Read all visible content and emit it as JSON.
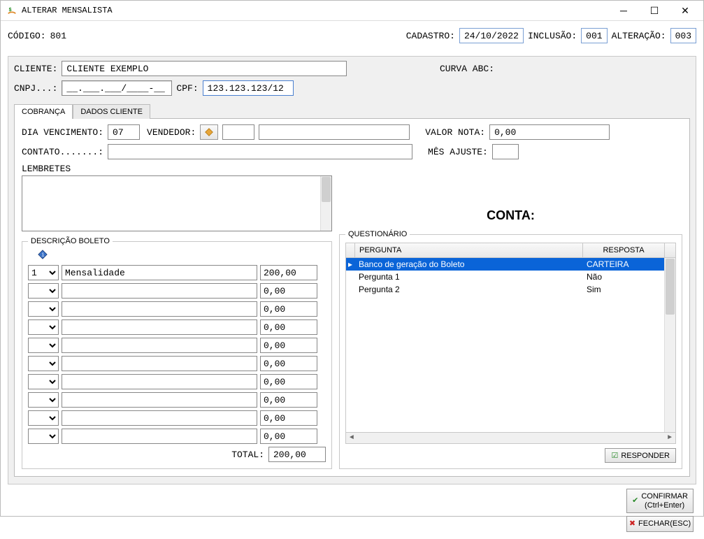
{
  "title": "ALTERAR MENSALISTA",
  "codigo_label": "CÓDIGO:",
  "codigo_value": "801",
  "cadastro_label": "CADASTRO:",
  "cadastro_value": "24/10/2022",
  "inclusao_label": "INCLUSÃO:",
  "inclusao_value": "001",
  "alteracao_label": "ALTERAÇÃO:",
  "alteracao_value": "003",
  "cliente_label": "CLIENTE:",
  "cliente_value": "CLIENTE EXEMPLO",
  "curva_label": "CURVA ABC:",
  "cnpj_label": "CNPJ...:",
  "cnpj_value": "__.___.___/____-__",
  "cpf_label": "CPF:",
  "cpf_value": "123.123.123/12",
  "tabs": {
    "cobranca": "COBRANÇA",
    "dados": "DADOS CLIENTE"
  },
  "dia_venc_label": "DIA VENCIMENTO:",
  "dia_venc_value": "07",
  "vendedor_label": "VENDEDOR:",
  "vendedor_code": "",
  "vendedor_name": "",
  "valor_nota_label": "VALOR NOTA:",
  "valor_nota_value": "0,00",
  "contato_label": "CONTATO.......:",
  "contato_value": "",
  "mes_ajuste_label": "MÊS AJUSTE:",
  "mes_ajuste_value": "",
  "lembretes_label": "LEMBRETES",
  "desc_boleto_legend": "DESCRIÇÃO BOLETO",
  "desc_rows": [
    {
      "opt": "1",
      "desc": "Mensalidade",
      "val": "200,00"
    },
    {
      "opt": "",
      "desc": "",
      "val": "0,00"
    },
    {
      "opt": "",
      "desc": "",
      "val": "0,00"
    },
    {
      "opt": "",
      "desc": "",
      "val": "0,00"
    },
    {
      "opt": "",
      "desc": "",
      "val": "0,00"
    },
    {
      "opt": "",
      "desc": "",
      "val": "0,00"
    },
    {
      "opt": "",
      "desc": "",
      "val": "0,00"
    },
    {
      "opt": "",
      "desc": "",
      "val": "0,00"
    },
    {
      "opt": "",
      "desc": "",
      "val": "0,00"
    },
    {
      "opt": "",
      "desc": "",
      "val": "0,00"
    }
  ],
  "total_label": "TOTAL:",
  "total_value": "200,00",
  "conta_title": "CONTA:",
  "quest_legend": "QUESTIONÁRIO",
  "quest_cols": {
    "pergunta": "PERGUNTA",
    "resposta": "RESPOSTA"
  },
  "quest_rows": [
    {
      "pergunta": "Banco de geração do Boleto",
      "resposta": "CARTEIRA",
      "selected": true
    },
    {
      "pergunta": "Pergunta 1",
      "resposta": "Não",
      "selected": false
    },
    {
      "pergunta": "Pergunta 2",
      "resposta": "Sim",
      "selected": false
    }
  ],
  "responder_btn": "RESPONDER",
  "confirmar_btn_line1": "CONFIRMAR",
  "confirmar_btn_line2": "(Ctrl+Enter)",
  "fechar_btn": "FECHAR(ESC)"
}
